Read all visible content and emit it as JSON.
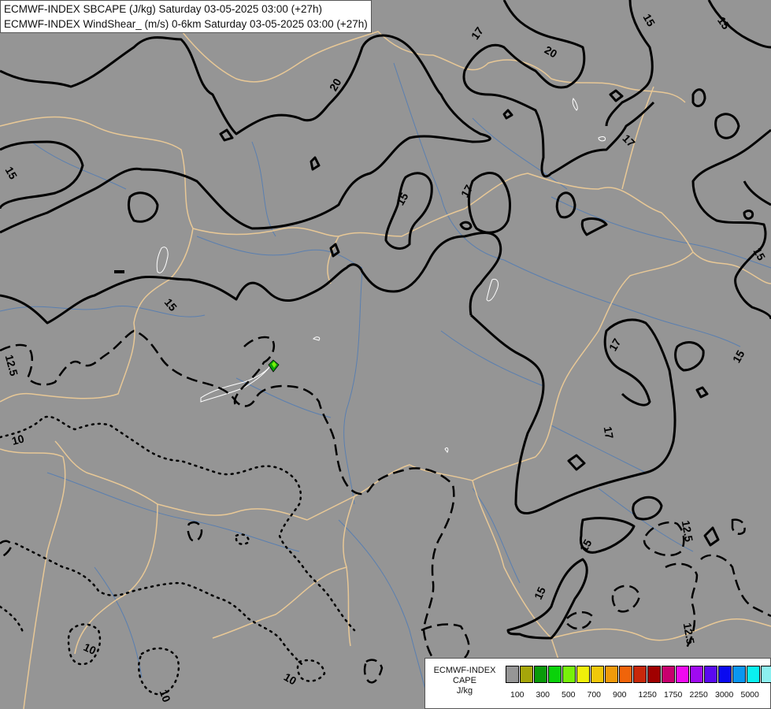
{
  "titles": {
    "line1": "ECMWF-INDEX SBCAPE (J/kg) Saturday 03-05-2025 03:00 (+27h)",
    "line2": "ECMWF-INDEX WindShear_ (m/s) 0-6km Saturday 03-05-2025 03:00 (+27h)"
  },
  "contour_labels": [
    "20",
    "17",
    "15",
    "20",
    "15",
    "17",
    "15",
    "17",
    "15",
    "15",
    "17",
    "15",
    "17",
    "15",
    "12.5",
    "10",
    "10",
    "10",
    "15",
    "12.5",
    "15",
    "12.5",
    "10",
    "17",
    "15"
  ],
  "legend": {
    "title_line1": "ECMWF-INDEX",
    "title_line2": "CAPE",
    "title_line3": "J/kg",
    "ticks": [
      "100",
      "300",
      "500",
      "700",
      "900",
      "1250",
      "1750",
      "2250",
      "3000",
      "5000"
    ],
    "colors": [
      "#969696",
      "#a6a60a",
      "#0a9a0a",
      "#0ad20a",
      "#78f00a",
      "#f0f00a",
      "#f0c80a",
      "#f09a0a",
      "#f0640a",
      "#c8280a",
      "#a00000",
      "#c8006e",
      "#f00af0",
      "#a00af0",
      "#5a0af0",
      "#0a0af0",
      "#0a96f0",
      "#0af0f0",
      "#8cf0f0",
      "#ffffff"
    ]
  }
}
